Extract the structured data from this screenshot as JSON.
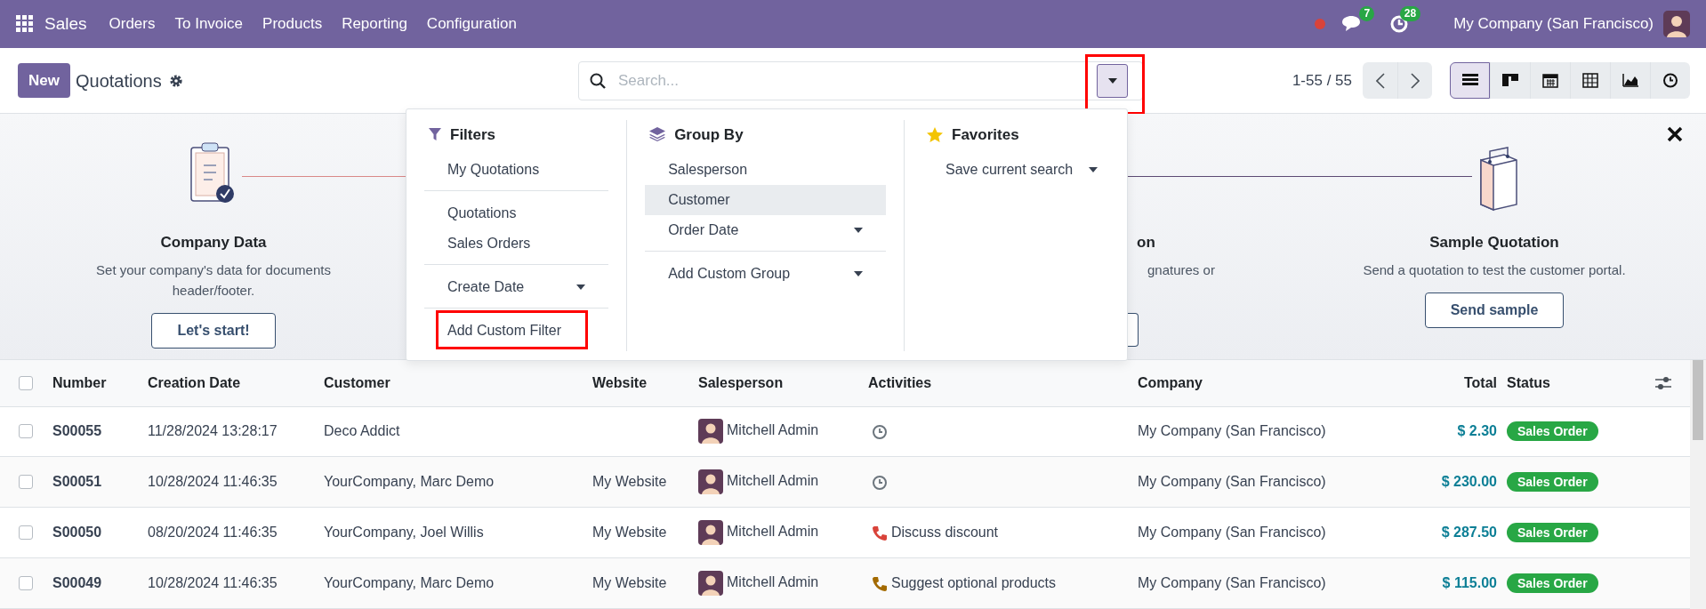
{
  "navbar": {
    "app_name": "Sales",
    "menu": [
      "Orders",
      "To Invoice",
      "Products",
      "Reporting",
      "Configuration"
    ],
    "messages_count": "7",
    "activities_count": "28",
    "company": "My Company (San Francisco)"
  },
  "control_panel": {
    "new_button": "New",
    "title": "Quotations",
    "search": {
      "placeholder": "Search...",
      "toggle_highlighted": true
    },
    "pager": "1-55 / 55",
    "views": [
      {
        "kind": "list",
        "selected": true
      },
      {
        "kind": "kanban",
        "selected": false
      },
      {
        "kind": "calendar",
        "selected": false
      },
      {
        "kind": "pivot",
        "selected": false
      },
      {
        "kind": "graph",
        "selected": false
      },
      {
        "kind": "activity",
        "selected": false
      }
    ]
  },
  "search_panel": {
    "sections": [
      {
        "kind": "filters",
        "title": "Filters",
        "groups": [
          [
            {
              "label": "My Quotations",
              "submenu": false,
              "hovered": false,
              "highlighted": false
            }
          ],
          [
            {
              "label": "Quotations",
              "submenu": false,
              "hovered": false,
              "highlighted": false
            },
            {
              "label": "Sales Orders",
              "submenu": false,
              "hovered": false,
              "highlighted": false
            }
          ],
          [
            {
              "label": "Create Date",
              "submenu": true,
              "hovered": false,
              "highlighted": false
            }
          ],
          [
            {
              "label": "Add Custom Filter",
              "submenu": false,
              "hovered": false,
              "highlighted": true
            }
          ]
        ]
      },
      {
        "kind": "group_by",
        "title": "Group By",
        "groups": [
          [
            {
              "label": "Salesperson",
              "submenu": false,
              "hovered": false,
              "highlighted": false
            },
            {
              "label": "Customer",
              "submenu": false,
              "hovered": true,
              "highlighted": false
            },
            {
              "label": "Order Date",
              "submenu": true,
              "hovered": false,
              "highlighted": false
            }
          ],
          [
            {
              "label": "Add Custom Group",
              "submenu": true,
              "hovered": false,
              "highlighted": false
            }
          ]
        ]
      },
      {
        "kind": "favorites",
        "title": "Favorites",
        "groups": [
          [
            {
              "label": "Save current search",
              "submenu": true,
              "hovered": false,
              "highlighted": false
            }
          ]
        ]
      }
    ]
  },
  "onboarding": {
    "steps": [
      {
        "kind": "full",
        "title": "Company Data",
        "description": "Set your company's data for documents header/footer.",
        "button": "Let's start!"
      },
      {
        "kind": "partial",
        "title": "on",
        "description": "gnatures or"
      },
      {
        "kind": "full",
        "title": "Sample Quotation",
        "description": "Send a quotation to test the customer portal.",
        "button": "Send sample"
      }
    ]
  },
  "table": {
    "select_all_checked": false,
    "columns": [
      "Number",
      "Creation Date",
      "Customer",
      "Website",
      "Salesperson",
      "Activities",
      "Company",
      "Total",
      "Status"
    ],
    "rows": [
      {
        "checked": false,
        "number": "S00055",
        "created": "11/28/2024 13:28:17",
        "customer": "Deco Addict",
        "salesperson": "Mitchell Admin",
        "activity": {
          "kind": "clock"
        },
        "company": "My Company (San Francisco)",
        "total": "$ 2.30",
        "status": {
          "label": "Sales Order",
          "color": "#28a745"
        }
      },
      {
        "checked": false,
        "number": "S00051",
        "created": "10/28/2024 11:46:35",
        "customer": "YourCompany, Marc Demo",
        "website": "My Website",
        "salesperson": "Mitchell Admin",
        "activity": {
          "kind": "clock"
        },
        "company": "My Company (San Francisco)",
        "total": "$ 230.00",
        "status": {
          "label": "Sales Order",
          "color": "#28a745"
        }
      },
      {
        "checked": false,
        "number": "S00050",
        "created": "08/20/2024 11:46:35",
        "customer": "YourCompany, Joel Willis",
        "website": "My Website",
        "salesperson": "Mitchell Admin",
        "activity": {
          "kind": "phone",
          "text": "Discuss discount",
          "color": "#d9433a"
        },
        "company": "My Company (San Francisco)",
        "total": "$ 287.50",
        "status": {
          "label": "Sales Order",
          "color": "#28a745"
        }
      },
      {
        "checked": false,
        "number": "S00049",
        "created": "10/28/2024 11:46:35",
        "customer": "YourCompany, Marc Demo",
        "website": "My Website",
        "salesperson": "Mitchell Admin",
        "activity": {
          "kind": "phone",
          "text": "Suggest optional products",
          "color": "#a36a00"
        },
        "company": "My Company (San Francisco)",
        "total": "$ 115.00",
        "status": {
          "label": "Sales Order",
          "color": "#28a745"
        }
      }
    ]
  }
}
